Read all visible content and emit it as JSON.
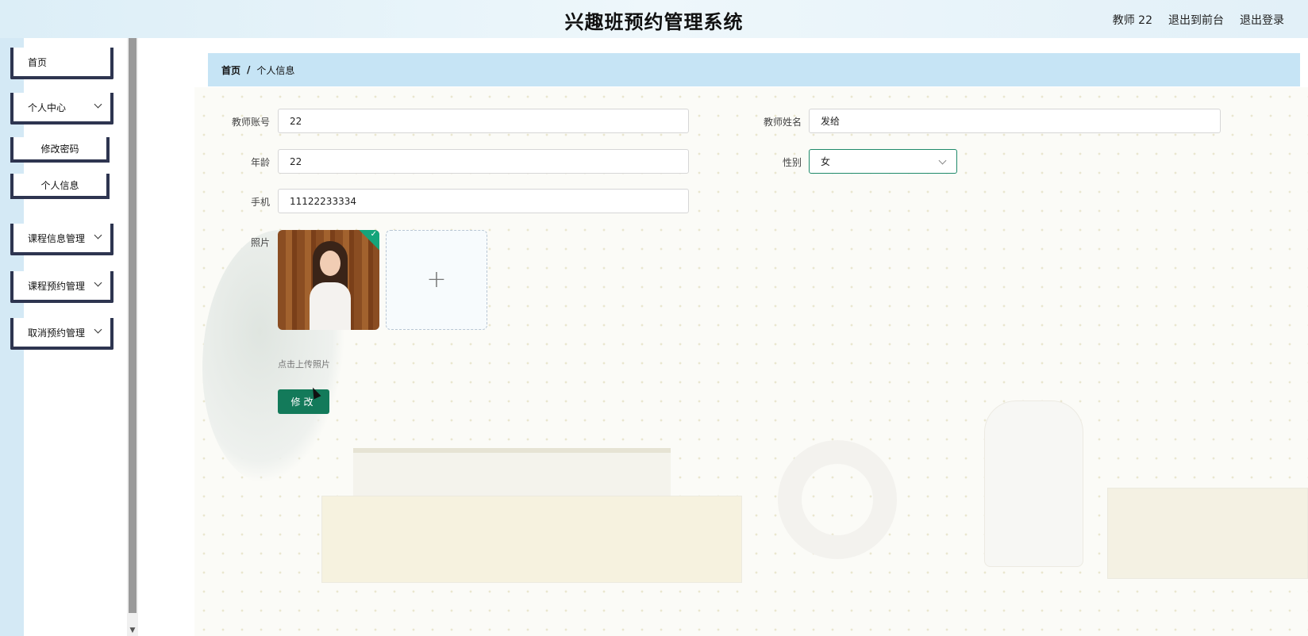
{
  "header": {
    "title": "兴趣班预约管理系统",
    "user": "教师 22",
    "front_link": "退出到前台",
    "logout": "退出登录"
  },
  "sidebar": {
    "items": [
      {
        "label": "首页"
      },
      {
        "label": "个人中心",
        "icon": "chevron-down-icon"
      },
      {
        "label": "修改密码"
      },
      {
        "label": "个人信息"
      },
      {
        "label": "课程信息管理",
        "icon": "chevron-down-icon"
      },
      {
        "label": "课程预约管理",
        "icon": "chevron-down-icon"
      },
      {
        "label": "取消预约管理",
        "icon": "chevron-down-icon"
      }
    ]
  },
  "breadcrumb": {
    "home": "首页",
    "separator": "/",
    "current": "个人信息"
  },
  "form": {
    "account_label": "教师账号",
    "account_value": "22",
    "name_label": "教师姓名",
    "name_value": "发给",
    "age_label": "年龄",
    "age_value": "22",
    "gender_label": "性别",
    "gender_value": "女",
    "phone_label": "手机",
    "phone_value": "11122233334",
    "photo_label": "照片",
    "upload_hint": "点击上传照片",
    "submit_label": "修改"
  },
  "colors": {
    "primary": "#137a5a",
    "breadcrumb_bg": "#c6e4f5",
    "sidebar_border": "#2e3550"
  }
}
